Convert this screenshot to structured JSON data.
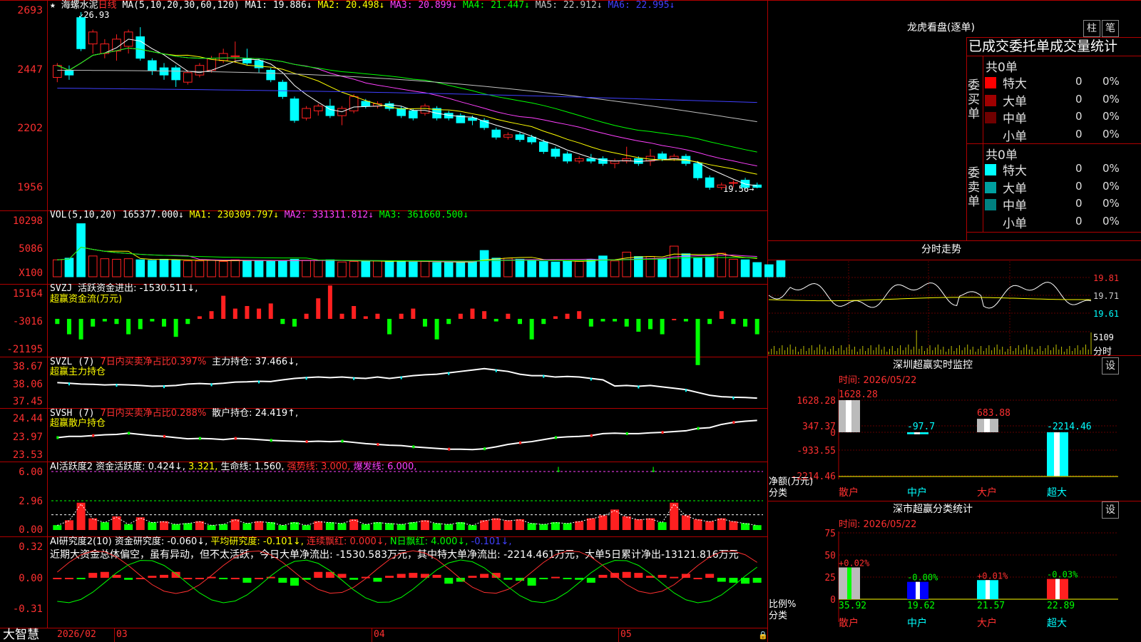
{
  "kline": {
    "star": "★",
    "name": "海螺水泥",
    "period": "日线",
    "ma_label": "MA(5,10,20,30,60,120)",
    "ma": [
      {
        "label": "MA1: 19.886↓",
        "color": "#ffffff"
      },
      {
        "label": "MA2: 20.498↓",
        "color": "#ffff00"
      },
      {
        "label": "MA3: 20.899↓",
        "color": "#ff40ff"
      },
      {
        "label": "MA4: 21.447↓",
        "color": "#00ff00"
      },
      {
        "label": "MA5: 22.912↓",
        "color": "#c0c0c0"
      },
      {
        "label": "MA6: 22.995↓",
        "color": "#4040ff"
      }
    ],
    "yticks": [
      "2693",
      "2447",
      "2202",
      "1956"
    ],
    "high_mark": "26.93",
    "low_mark": "19.56",
    "ohlc": [
      [
        24.2,
        24.7,
        24.0,
        24.8
      ],
      [
        24.5,
        24.3,
        24.1,
        24.7
      ],
      [
        26.7,
        25.4,
        25.3,
        26.93
      ],
      [
        25.6,
        26.1,
        25.2,
        26.2
      ],
      [
        25.2,
        25.6,
        25.0,
        25.8
      ],
      [
        25.3,
        25.8,
        24.9,
        26.0
      ],
      [
        25.5,
        26.1,
        25.2,
        26.2
      ],
      [
        25.9,
        25.0,
        24.9,
        26.3
      ],
      [
        24.9,
        24.5,
        24.3,
        25.0
      ],
      [
        24.6,
        24.3,
        24.1,
        24.8
      ],
      [
        24.6,
        24.1,
        23.8,
        24.7
      ],
      [
        24.0,
        24.4,
        23.9,
        24.5
      ],
      [
        24.3,
        24.7,
        24.2,
        24.8
      ],
      [
        24.5,
        25.0,
        24.4,
        25.1
      ],
      [
        24.9,
        25.2,
        24.8,
        25.4
      ],
      [
        25.1,
        25.1,
        24.8,
        25.7
      ],
      [
        25.0,
        24.8,
        24.7,
        25.4
      ],
      [
        24.9,
        24.6,
        24.4,
        25.0
      ],
      [
        24.5,
        24.1,
        24.0,
        24.6
      ],
      [
        24.0,
        23.4,
        23.3,
        24.1
      ],
      [
        23.3,
        22.4,
        22.3,
        23.4
      ],
      [
        22.5,
        22.9,
        22.4,
        23.0
      ],
      [
        22.8,
        23.0,
        22.6,
        23.1
      ],
      [
        23.0,
        22.6,
        22.5,
        23.3
      ],
      [
        22.6,
        22.9,
        22.2,
        23.0
      ],
      [
        22.8,
        23.4,
        22.7,
        23.5
      ],
      [
        23.2,
        23.0,
        22.9,
        23.3
      ],
      [
        23.0,
        23.1,
        22.9,
        23.2
      ],
      [
        23.1,
        22.9,
        22.8,
        23.2
      ],
      [
        22.9,
        22.6,
        22.5,
        23.0
      ],
      [
        22.8,
        22.5,
        22.4,
        22.9
      ],
      [
        22.7,
        23.0,
        22.6,
        23.1
      ],
      [
        22.9,
        22.5,
        22.4,
        23.0
      ],
      [
        22.7,
        22.5,
        22.4,
        22.8
      ],
      [
        22.6,
        22.3,
        22.3,
        22.7
      ],
      [
        22.5,
        22.4,
        22.2,
        22.6
      ],
      [
        22.4,
        22.1,
        22.0,
        22.5
      ],
      [
        22.0,
        21.7,
        21.6,
        22.1
      ],
      [
        21.7,
        21.8,
        21.6,
        21.9
      ],
      [
        21.8,
        21.6,
        21.5,
        21.9
      ],
      [
        21.7,
        21.5,
        21.4,
        21.8
      ],
      [
        21.5,
        21.1,
        21.0,
        21.6
      ],
      [
        21.2,
        20.9,
        20.8,
        21.3
      ],
      [
        21.0,
        20.7,
        20.6,
        21.1
      ],
      [
        20.7,
        20.8,
        20.6,
        20.9
      ],
      [
        20.8,
        20.7,
        20.6,
        21.0
      ],
      [
        20.8,
        20.6,
        20.5,
        20.9
      ],
      [
        20.6,
        20.7,
        20.4,
        20.8
      ],
      [
        20.7,
        20.8,
        20.6,
        21.3
      ],
      [
        20.8,
        20.6,
        20.5,
        20.9
      ],
      [
        20.7,
        20.9,
        20.5,
        21.2
      ],
      [
        21.0,
        20.8,
        20.7,
        21.1
      ],
      [
        20.8,
        20.9,
        20.7,
        21.0
      ],
      [
        20.9,
        20.6,
        20.5,
        21.0
      ],
      [
        20.6,
        20.0,
        19.9,
        20.7
      ],
      [
        20.0,
        19.6,
        19.5,
        20.1
      ],
      [
        19.6,
        19.7,
        19.5,
        19.8
      ],
      [
        19.8,
        19.8,
        19.6,
        19.9
      ],
      [
        19.9,
        19.6,
        19.56,
        20.0
      ],
      [
        19.7,
        19.6,
        19.56,
        19.8
      ]
    ]
  },
  "vol": {
    "label": "VOL(5,10,20)",
    "value": "165377.000↓",
    "ma": [
      {
        "label": "MA1: 230309.797↓",
        "color": "#ffff00"
      },
      {
        "label": "MA2: 331311.812↓",
        "color": "#ff40ff"
      },
      {
        "label": "MA3: 361660.500↓",
        "color": "#00ff00"
      }
    ],
    "yticks": [
      "10298",
      "5086",
      "X100"
    ],
    "values": [
      3100,
      3400,
      9700,
      3800,
      3300,
      3200,
      3300,
      3100,
      3000,
      3200,
      3100,
      2900,
      2900,
      3000,
      2800,
      3100,
      3000,
      3000,
      2800,
      2900,
      3200,
      3000,
      3000,
      3100,
      2700,
      2800,
      2900,
      2900,
      2800,
      2900,
      2700,
      2800,
      2600,
      2600,
      2700,
      2800,
      4800,
      3400,
      3400,
      3200,
      3000,
      2800,
      2700,
      2900,
      2800,
      3200,
      3800,
      2900,
      4500,
      3700,
      3700,
      3300,
      5600,
      4200,
      3500,
      3600,
      4300,
      3200,
      3100,
      2600,
      2200,
      3000
    ]
  },
  "svzj": {
    "label": "SVZJ",
    "text": "活跃资金进出: -1530.511↓,",
    "sub": "超赢资金流(万元)",
    "yticks": [
      "15164",
      "-3016",
      "-21195"
    ],
    "values": [
      -2,
      -6,
      -8,
      -3,
      -1,
      -2,
      -6,
      -4,
      -1,
      -3,
      -7,
      -2,
      1,
      3,
      9,
      4,
      5,
      4,
      6,
      -2,
      -3,
      2,
      8,
      13,
      2,
      5,
      1,
      2,
      -6,
      2,
      4,
      -3,
      -8,
      -2,
      2,
      4,
      3,
      -1,
      2,
      -2,
      -8,
      -2,
      1,
      2,
      3,
      -3,
      -1,
      -1,
      -3,
      -5,
      -4,
      -6,
      0,
      -1,
      -18,
      -2,
      3,
      -2,
      -3,
      -6,
      -2,
      -4
    ]
  },
  "svzl": {
    "label": "SVZL (7)",
    "red": "7日内买卖净占比0.397%",
    "text": "主力持仓: 37.466↓,",
    "sub": "超赢主力持仓",
    "yticks": [
      "38.67",
      "38.06",
      "37.45"
    ],
    "values": [
      38.1,
      38.08,
      38.05,
      38.04,
      38.02,
      38.03,
      38.02,
      38.0,
      37.97,
      37.98,
      38.0,
      38.05,
      38.07,
      38.05,
      38.08,
      38.12,
      38.13,
      38.15,
      38.14,
      38.2,
      38.25,
      38.28,
      38.3,
      38.28,
      38.3,
      38.27,
      38.25,
      38.3,
      38.25,
      38.3,
      38.35,
      38.38,
      38.4,
      38.45,
      38.5,
      38.55,
      38.6,
      38.55,
      38.5,
      38.4,
      38.35,
      38.35,
      38.3,
      38.32,
      38.3,
      38.25,
      38.2,
      37.98,
      38.0,
      37.97,
      38.0,
      37.95,
      37.9,
      37.85,
      37.75,
      37.65,
      37.6,
      37.58,
      37.57,
      37.55
    ]
  },
  "svsh": {
    "label": "SVSH (7)",
    "red": "7日内买卖净占比0.288%",
    "text": "散户持仓: 24.419↑,",
    "sub": "超赢散户持仓",
    "yticks": [
      "24.44",
      "23.97",
      "23.53"
    ],
    "values": [
      23.95,
      23.98,
      23.98,
      24.0,
      24.02,
      24.03,
      24.06,
      24.03,
      24.0,
      23.98,
      23.95,
      23.92,
      23.93,
      23.92,
      23.9,
      23.93,
      23.92,
      23.9,
      23.88,
      23.87,
      23.86,
      23.85,
      23.86,
      23.85,
      23.86,
      23.83,
      23.8,
      23.78,
      23.76,
      23.75,
      23.72,
      23.7,
      23.68,
      23.66,
      23.66,
      23.65,
      23.67,
      23.72,
      23.78,
      23.82,
      23.85,
      23.9,
      23.95,
      23.97,
      23.98,
      24.0,
      24.05,
      24.06,
      24.05,
      24.05,
      24.07,
      24.08,
      24.1,
      24.12,
      24.18,
      24.2,
      24.28,
      24.33,
      24.36,
      24.38
    ]
  },
  "ai1": {
    "label": "AI活跃度2",
    "text": "资金活跃度: 0.424↓,",
    "yellow": "3.321,",
    "life": "生命线: 1.560,",
    "strong": "强势线: 3.000,",
    "burst": "爆发线: 6.000,",
    "yticks": [
      "6.00",
      "2.96",
      "0.00"
    ],
    "values": [
      0.5,
      1.0,
      2.8,
      1.2,
      0.8,
      1.4,
      0.6,
      1.3,
      0.8,
      0.9,
      0.6,
      0.7,
      0.9,
      0.5,
      0.6,
      1.1,
      0.7,
      0.9,
      0.8,
      0.5,
      0.8,
      0.5,
      0.9,
      0.8,
      0.7,
      1.1,
      0.6,
      0.8,
      0.7,
      0.6,
      0.8,
      1.0,
      0.7,
      0.6,
      0.8,
      0.5,
      1.0,
      1.2,
      1.0,
      1.1,
      0.7,
      0.6,
      0.8,
      0.7,
      0.9,
      1.2,
      1.5,
      2.1,
      1.4,
      1.1,
      1.2,
      0.8,
      2.8,
      1.5,
      1.1,
      0.9,
      1.2,
      0.9,
      0.7,
      0.5,
      0.8,
      0.6
    ]
  },
  "ai2": {
    "label": "AI研究度2(10)",
    "text": "资金研究度: -0.060↓,",
    "avg": "平均研究度: -0.101↓,",
    "red1": "连续飘红: 0.000↓,",
    "green1": "N日飘红: 4.000↓,",
    "blue1": "-0.101↓,",
    "comment": "近期大资金总体偏空，虽有异动，但不太活跃，今日大单净流出: -1530.583万元，其中特大单净流出: -2214.461万元，大单5日累计净出-13121.816万元",
    "yticks": [
      "0.32",
      "0.00",
      "-0.31"
    ],
    "values": [
      0.0,
      0.0,
      -0.01,
      0.05,
      0.06,
      0.03,
      -0.02,
      0.0,
      0.02,
      0.03,
      0.06,
      0.0,
      0.0,
      0.01,
      -0.01,
      0.0,
      -0.05,
      0.0,
      0.01,
      -0.05,
      -0.08,
      -0.02,
      0.06,
      0.06,
      0.04,
      -0.02,
      0.01,
      -0.04,
      0.02,
      0.04,
      0.05,
      0.04,
      0.03,
      -0.06,
      -0.04,
      0.02,
      0.04,
      0.05,
      -0.02,
      -0.03,
      -0.08,
      -0.01,
      0.01,
      -0.01,
      -0.02,
      -0.05,
      0.03,
      0.05,
      0.06,
      0.05,
      0.02,
      0.03,
      0.01,
      0.04,
      0.0,
      0.04,
      -0.04,
      -0.05,
      -0.06,
      -0.05,
      0.06,
      -0.04
    ]
  },
  "bottom": {
    "brand": "大智慧",
    "dates": [
      "2026/02",
      "03",
      "04",
      "05"
    ]
  },
  "dragon": {
    "title": "龙虎看盘(逐单)",
    "btn_zhu": "柱",
    "btn_bi": "笔",
    "header": "已成交委托单成交量统计",
    "buy": {
      "title": "共0单",
      "side": "委买单",
      "rows": [
        {
          "label": "特大",
          "v": "0",
          "p": "0%",
          "color": "#ff0000"
        },
        {
          "label": "大单",
          "v": "0",
          "p": "0%",
          "color": "#a00000"
        },
        {
          "label": "中单",
          "v": "0",
          "p": "0%",
          "color": "#700000"
        },
        {
          "label": "小单",
          "v": "0",
          "p": "0%",
          "color": ""
        }
      ]
    },
    "sell": {
      "title": "共0单",
      "side": "委卖单",
      "rows": [
        {
          "label": "特大",
          "v": "0",
          "p": "0%",
          "color": "#00ffff"
        },
        {
          "label": "大单",
          "v": "0",
          "p": "0%",
          "color": "#00a0a0"
        },
        {
          "label": "中单",
          "v": "0",
          "p": "0%",
          "color": "#008080"
        },
        {
          "label": "小单",
          "v": "0",
          "p": "0%",
          "color": ""
        }
      ]
    }
  },
  "intraday": {
    "title": "分时走势",
    "yticks": [
      "19.81",
      "19.71",
      "19.61"
    ],
    "vol_tick": "5109",
    "vol_unit": "分时"
  },
  "monitor": {
    "title": "深圳超赢实时监控",
    "btn": "设",
    "time": "时间: 2026/05/22",
    "yticks": [
      "1628.28",
      "347.37",
      "0",
      "-933.55",
      "-2214.46"
    ],
    "ylabel": "净额(万元)",
    "xlabel": "分类",
    "cats": [
      "散户",
      "中户",
      "大户",
      "超大"
    ],
    "values": [
      "1628.28",
      "-97.7",
      "683.88",
      "-2214.46"
    ],
    "nums": [
      1628.28,
      -97.7,
      683.88,
      -2214.46
    ]
  },
  "classify": {
    "title": "深市超赢分类统计",
    "btn": "设",
    "time": "时间: 2026/05/22",
    "yticks": [
      "75",
      "50",
      "25",
      "0"
    ],
    "ylabel": "比例%",
    "xlabel": "分类",
    "cats": [
      "散户",
      "中户",
      "大户",
      "超大"
    ],
    "changes": [
      "+0.02%",
      "-0.00%",
      "+0.01%",
      "-0.03%"
    ],
    "values": [
      "35.92",
      "19.62",
      "21.57",
      "22.89"
    ],
    "nums": [
      35.92,
      19.62,
      21.57,
      22.89
    ]
  },
  "colors": {
    "up": "#ff2020",
    "down": "#00ffff",
    "grid": "#b00000",
    "green": "#00ff00"
  }
}
